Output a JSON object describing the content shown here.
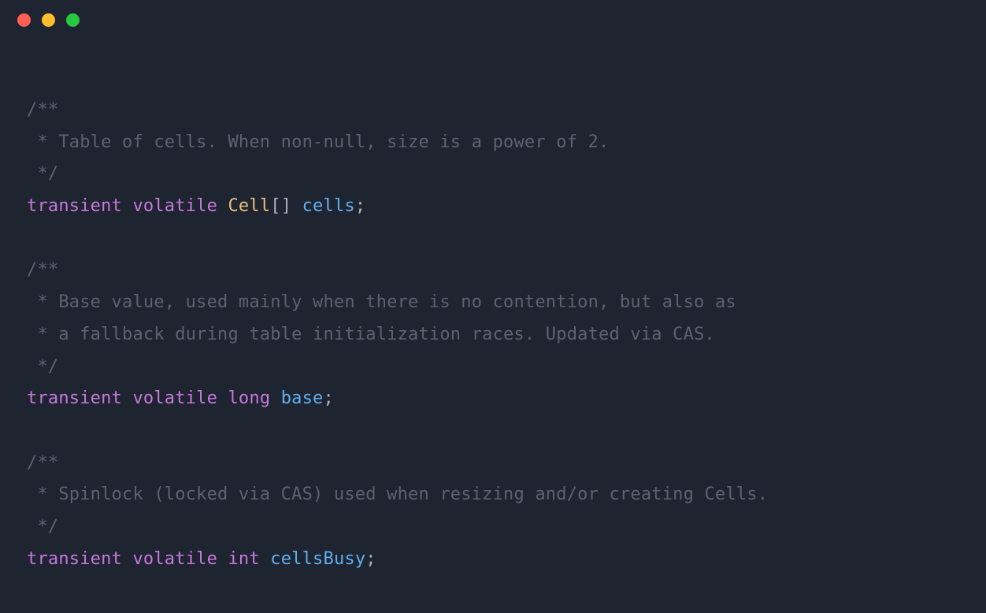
{
  "colors": {
    "background": "#1e2430",
    "comment": "#5c6370",
    "keyword": "#c678dd",
    "type": "#e5c07b",
    "identifier": "#61afef",
    "punct": "#abb2bf",
    "traffic_red": "#ff5f56",
    "traffic_yellow": "#ffbd2e",
    "traffic_green": "#27c93f"
  },
  "code": {
    "lines": [
      [
        {
          "t": "comment",
          "v": "/**"
        }
      ],
      [
        {
          "t": "comment",
          "v": " * Table of cells. When non-null, size is a power of 2."
        }
      ],
      [
        {
          "t": "comment",
          "v": " */"
        }
      ],
      [
        {
          "t": "keyword",
          "v": "transient"
        },
        {
          "t": "punct",
          "v": " "
        },
        {
          "t": "keyword",
          "v": "volatile"
        },
        {
          "t": "punct",
          "v": " "
        },
        {
          "t": "type",
          "v": "Cell"
        },
        {
          "t": "punct",
          "v": "[] "
        },
        {
          "t": "identifier",
          "v": "cells"
        },
        {
          "t": "punct",
          "v": ";"
        }
      ],
      [],
      [
        {
          "t": "comment",
          "v": "/**"
        }
      ],
      [
        {
          "t": "comment",
          "v": " * Base value, used mainly when there is no contention, but also as"
        }
      ],
      [
        {
          "t": "comment",
          "v": " * a fallback during table initialization races. Updated via CAS."
        }
      ],
      [
        {
          "t": "comment",
          "v": " */"
        }
      ],
      [
        {
          "t": "keyword",
          "v": "transient"
        },
        {
          "t": "punct",
          "v": " "
        },
        {
          "t": "keyword",
          "v": "volatile"
        },
        {
          "t": "punct",
          "v": " "
        },
        {
          "t": "keyword",
          "v": "long"
        },
        {
          "t": "punct",
          "v": " "
        },
        {
          "t": "identifier",
          "v": "base"
        },
        {
          "t": "punct",
          "v": ";"
        }
      ],
      [],
      [
        {
          "t": "comment",
          "v": "/**"
        }
      ],
      [
        {
          "t": "comment",
          "v": " * Spinlock (locked via CAS) used when resizing and/or creating Cells."
        }
      ],
      [
        {
          "t": "comment",
          "v": " */"
        }
      ],
      [
        {
          "t": "keyword",
          "v": "transient"
        },
        {
          "t": "punct",
          "v": " "
        },
        {
          "t": "keyword",
          "v": "volatile"
        },
        {
          "t": "punct",
          "v": " "
        },
        {
          "t": "keyword",
          "v": "int"
        },
        {
          "t": "punct",
          "v": " "
        },
        {
          "t": "identifier",
          "v": "cellsBusy"
        },
        {
          "t": "punct",
          "v": ";"
        }
      ]
    ]
  }
}
